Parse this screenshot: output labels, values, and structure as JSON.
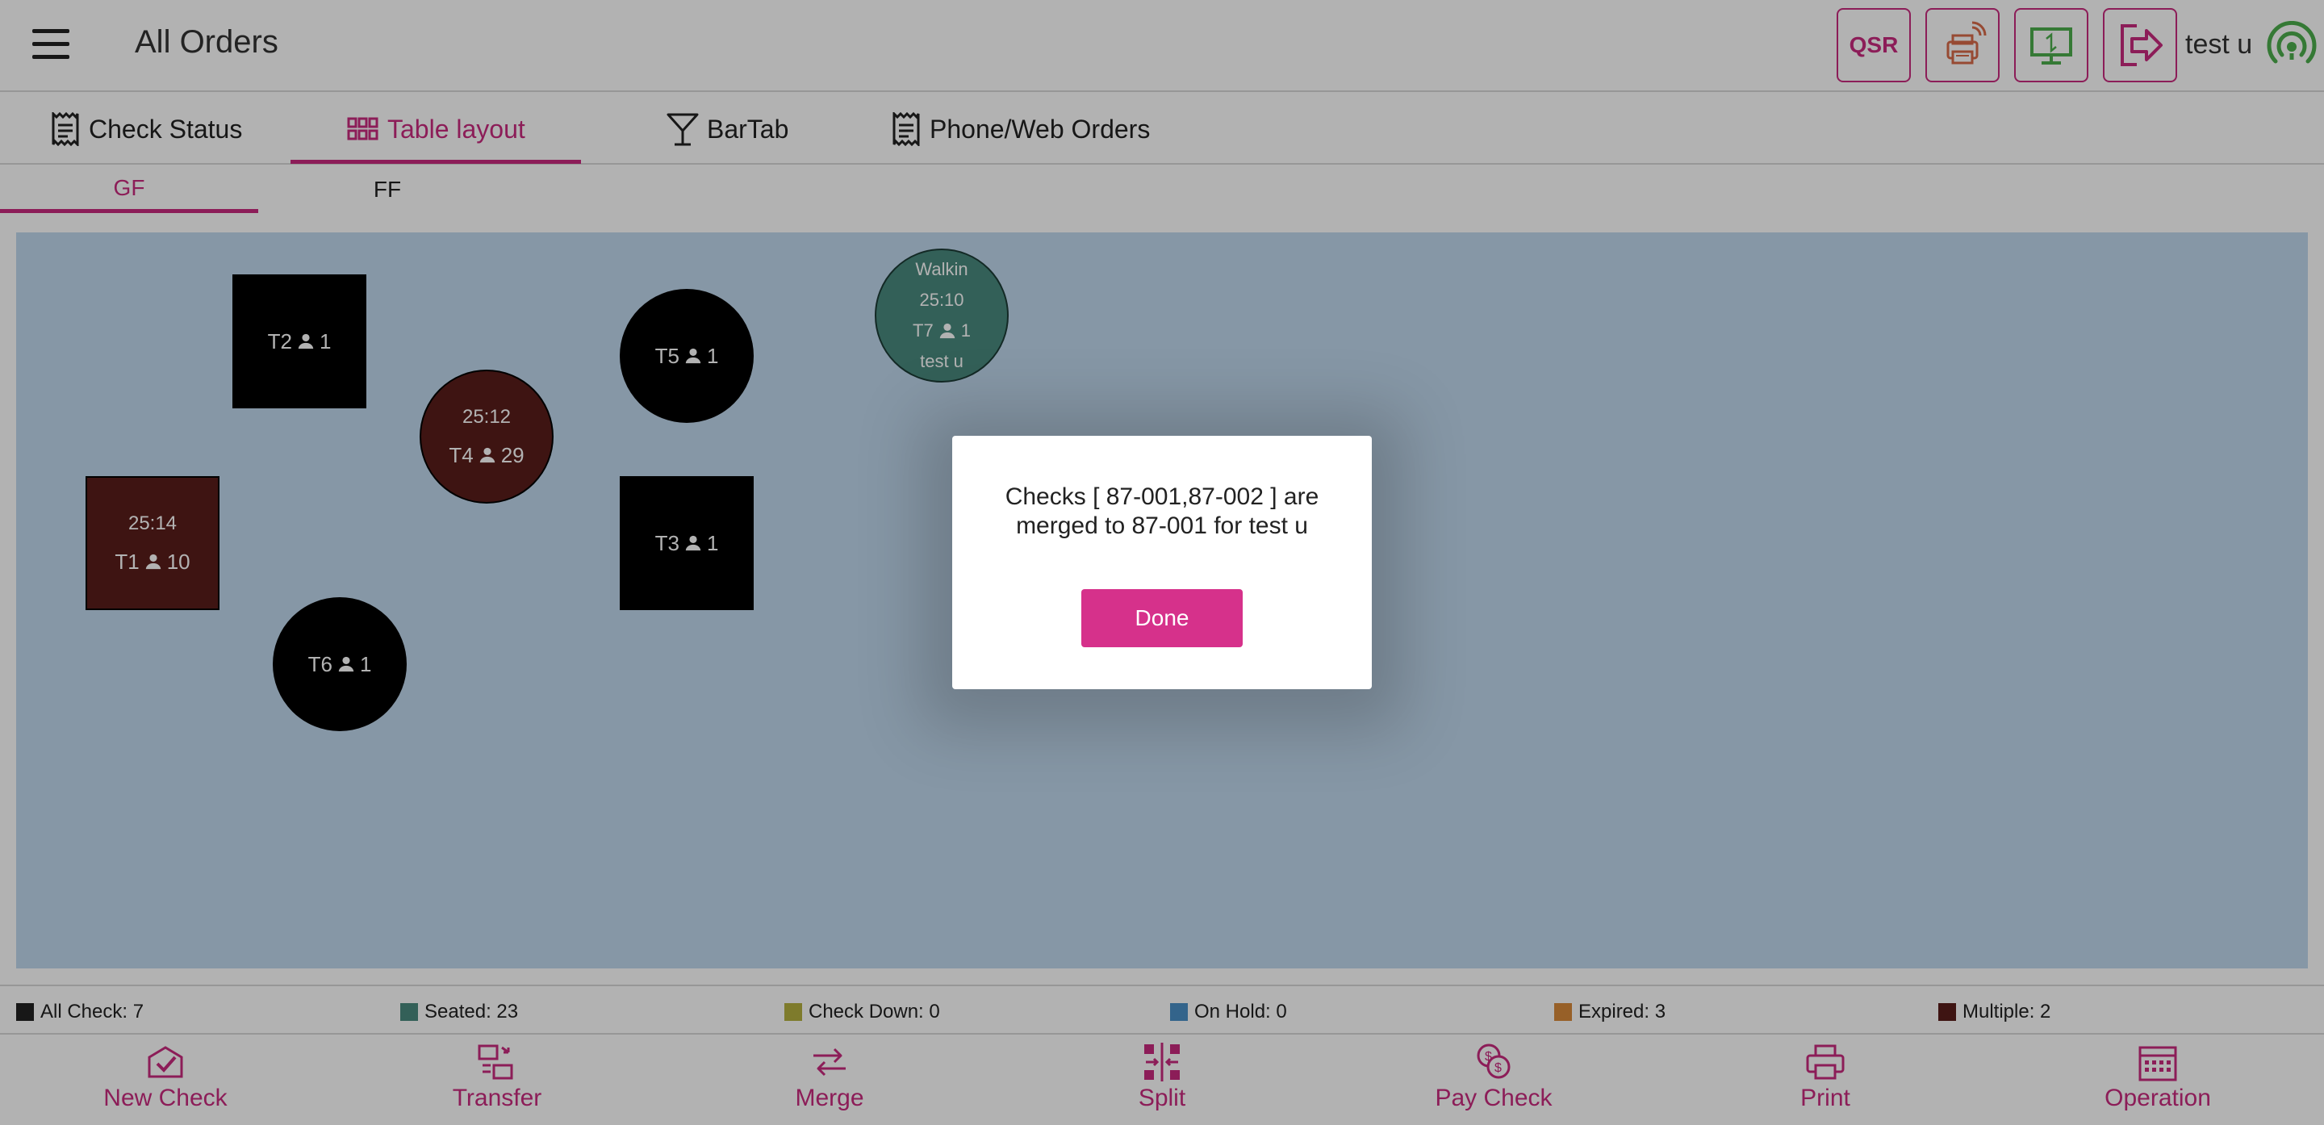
{
  "header": {
    "title": "All Orders",
    "qsr_label": "QSR",
    "user_name": "test u"
  },
  "tabs": [
    {
      "label": "Check Status",
      "icon": "receipt-icon"
    },
    {
      "label": "Table layout",
      "icon": "grid-icon",
      "active": true
    },
    {
      "label": "BarTab",
      "icon": "cocktail-icon"
    },
    {
      "label": "Phone/Web Orders",
      "icon": "receipt-icon"
    }
  ],
  "floors": [
    {
      "label": "GF",
      "active": true
    },
    {
      "label": "FF"
    }
  ],
  "tables": {
    "t2": {
      "name": "T2",
      "guests": "1"
    },
    "t5": {
      "name": "T5",
      "guests": "1"
    },
    "t7": {
      "source": "Walkin",
      "timer": "25:10",
      "name": "T7",
      "guests": "1",
      "server": "test u"
    },
    "t4": {
      "timer": "25:12",
      "name": "T4",
      "guests": "29"
    },
    "t1": {
      "timer": "25:14",
      "name": "T1",
      "guests": "10"
    },
    "t3": {
      "name": "T3",
      "guests": "1"
    },
    "t6": {
      "name": "T6",
      "guests": "1"
    }
  },
  "legend": [
    {
      "label": "All Check: 7",
      "color": "#222222"
    },
    {
      "label": "Seated: 23",
      "color": "#4a8a7e"
    },
    {
      "label": "Check Down: 0",
      "color": "#b5b040"
    },
    {
      "label": "On Hold: 0",
      "color": "#4a90c8"
    },
    {
      "label": "Expired: 3",
      "color": "#d98a3a"
    },
    {
      "label": "Multiple: 2",
      "color": "#5a1d1a"
    }
  ],
  "bottom_bar": [
    {
      "label": "New Check",
      "icon": "new-check-icon"
    },
    {
      "label": "Transfer",
      "icon": "transfer-icon"
    },
    {
      "label": "Merge",
      "icon": "merge-icon"
    },
    {
      "label": "Split",
      "icon": "split-icon"
    },
    {
      "label": "Pay Check",
      "icon": "pay-check-icon"
    },
    {
      "label": "Print",
      "icon": "print-icon"
    },
    {
      "label": "Operation",
      "icon": "calendar-icon"
    }
  ],
  "modal": {
    "message": "Checks [ 87-001,87-002 ] are merged to 87-001 for test u",
    "done_label": "Done"
  },
  "colors": {
    "accent": "#c92a7e",
    "table_area_bg": "#c0d9ee",
    "multiple": "#5a1d1a",
    "seated": "#4a8a7e"
  }
}
